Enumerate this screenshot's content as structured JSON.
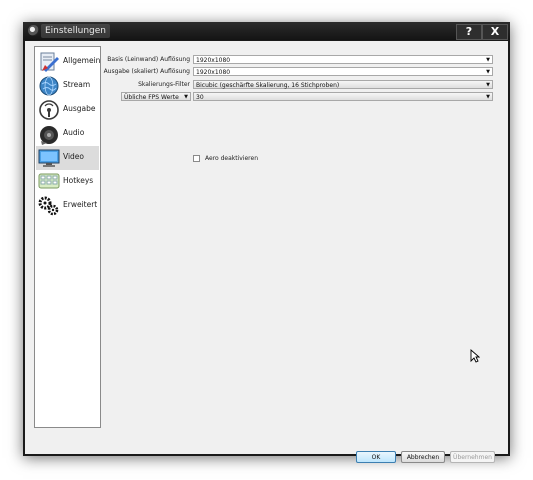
{
  "window": {
    "title": "Einstellungen",
    "help_glyph": "?",
    "close_glyph": "X"
  },
  "sidebar": {
    "items": [
      {
        "label": "Allgemein",
        "icon": "general-icon"
      },
      {
        "label": "Stream",
        "icon": "stream-globe-icon"
      },
      {
        "label": "Ausgabe",
        "icon": "output-icon"
      },
      {
        "label": "Audio",
        "icon": "speaker-icon"
      },
      {
        "label": "Video",
        "icon": "monitor-icon",
        "selected": true
      },
      {
        "label": "Hotkeys",
        "icon": "keyboard-icon"
      },
      {
        "label": "Erweitert",
        "icon": "gears-icon"
      }
    ]
  },
  "video": {
    "base_label": "Basis (Leinwand) Auflösung",
    "base_value": "1920x1080",
    "output_label": "Ausgabe (skaliert) Auflösung",
    "output_value": "1920x1080",
    "filter_label": "Skalierungs-Filter",
    "filter_value": "Bicubic (geschärfte Skalierung, 16 Stichproben)",
    "fps_mode": "Übliche FPS Werte",
    "fps_value": "30",
    "aero_label": "Aero deaktivieren",
    "aero_checked": false
  },
  "buttons": {
    "ok": "OK",
    "cancel": "Abbrechen",
    "apply": "Übernehmen"
  }
}
